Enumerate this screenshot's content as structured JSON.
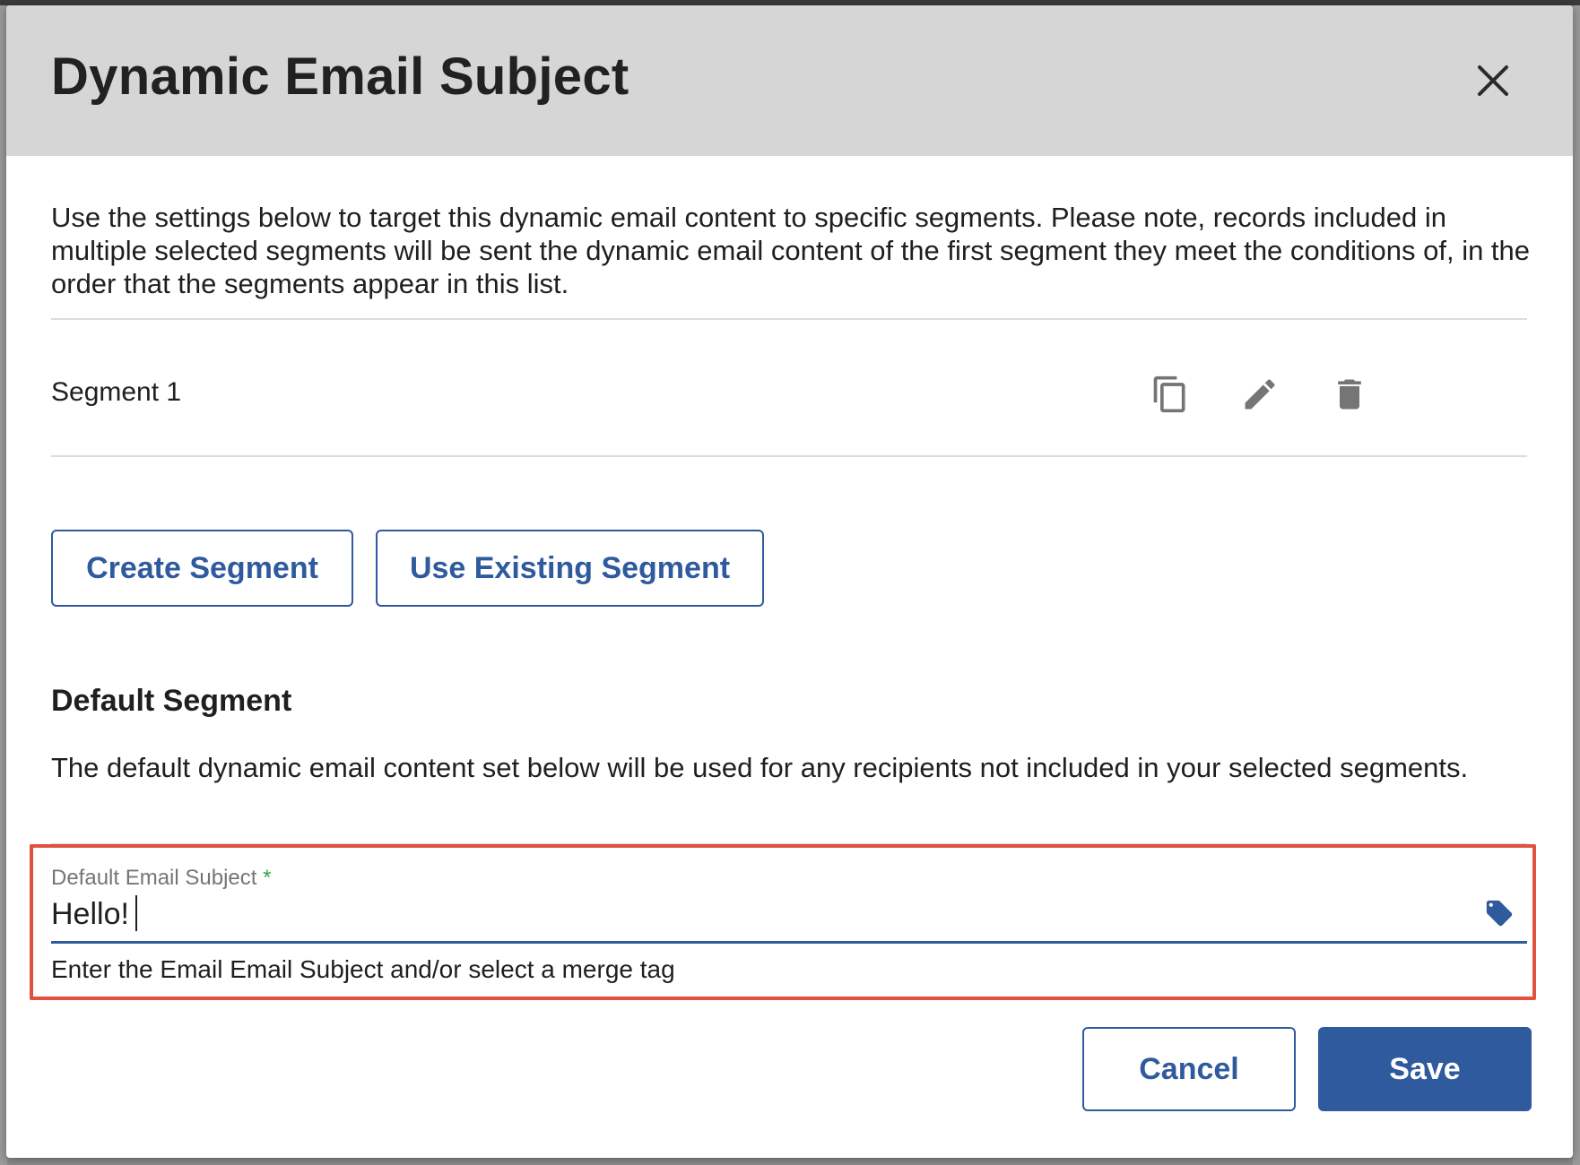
{
  "modal": {
    "title": "Dynamic Email Subject",
    "intro": "Use the settings below to target this dynamic email content to specific segments. Please note, records included in multiple selected segments will be sent the dynamic email content of the first segment they meet the conditions of, in the order that the segments appear in this list."
  },
  "segments": [
    {
      "name": "Segment 1",
      "actions": [
        "copy-icon",
        "pencil-icon",
        "trash-icon"
      ]
    }
  ],
  "segment_buttons": {
    "create": "Create Segment",
    "use_existing": "Use Existing Segment"
  },
  "default_segment": {
    "heading": "Default Segment",
    "description": "The default dynamic email content set below will be used for any recipients not included in your selected segments."
  },
  "subject_field": {
    "label": "Default Email Subject",
    "required_marker": "*",
    "value": "Hello!",
    "helper": "Enter the Email Email Subject and/or select a merge tag",
    "icon": "tag-icon"
  },
  "footer": {
    "cancel": "Cancel",
    "save": "Save"
  },
  "colors": {
    "accent": "#2f5a9e",
    "header_bg": "#d6d6d6",
    "highlight": "#e0513f",
    "required": "#3aa14a"
  }
}
